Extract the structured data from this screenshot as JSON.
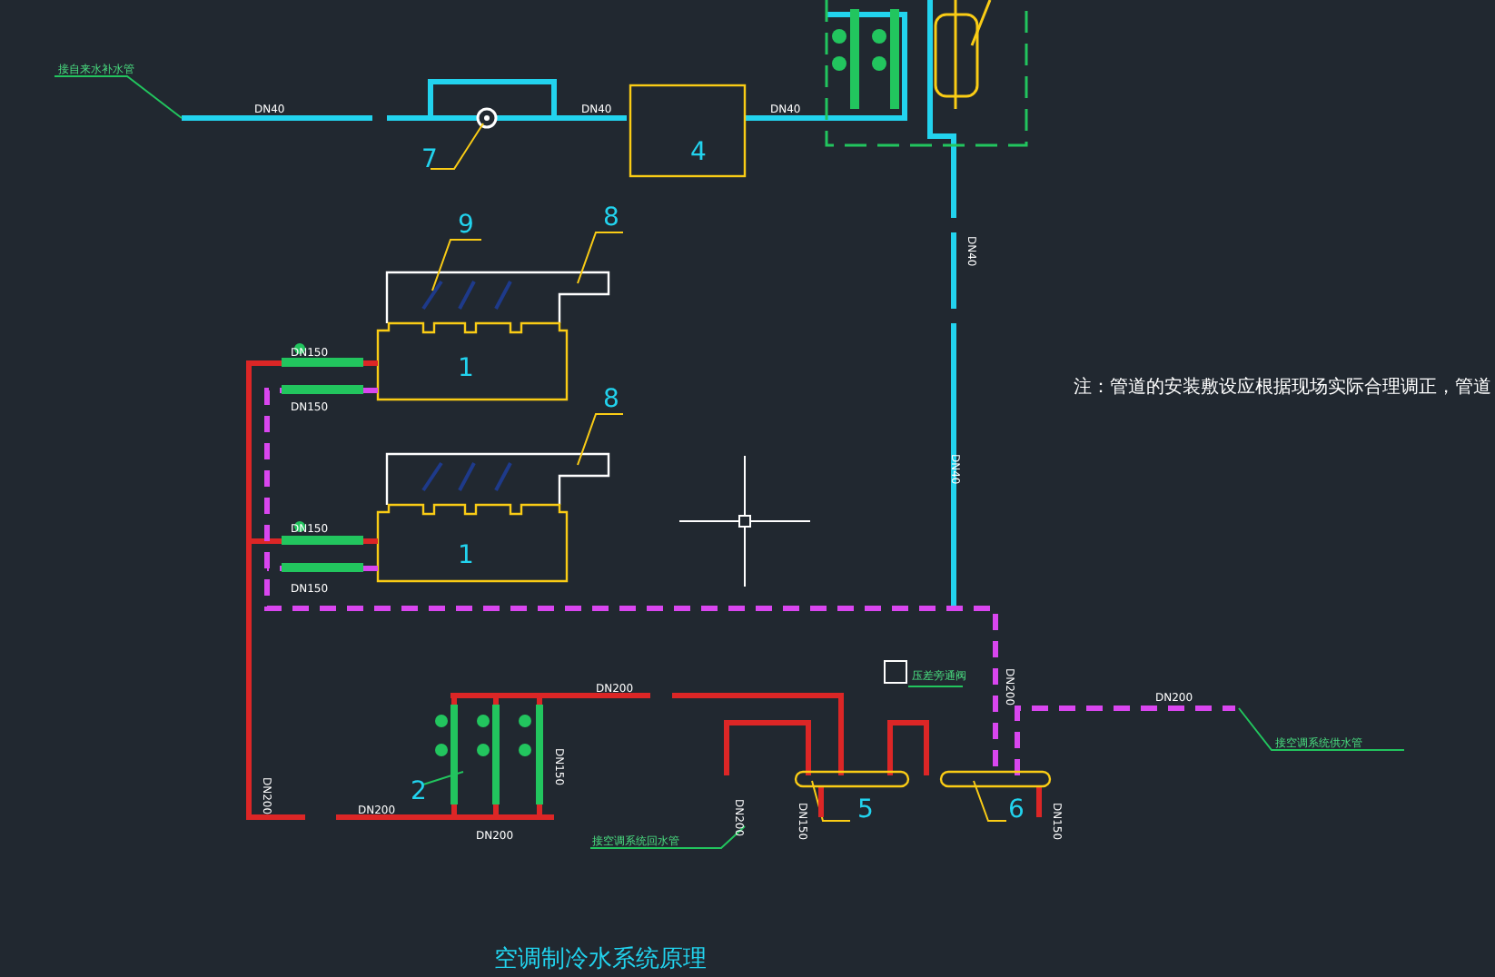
{
  "drawing": {
    "labels": [
      {
        "kind": "callout",
        "text": "接自来水补水管"
      },
      {
        "kind": "dn",
        "text": "DN40"
      },
      {
        "kind": "dn",
        "text": "DN40"
      },
      {
        "kind": "dn",
        "text": "DN40"
      },
      {
        "kind": "dn_v",
        "text": "DN40"
      },
      {
        "kind": "dn_v",
        "text": "DN40"
      },
      {
        "kind": "number",
        "text": "7"
      },
      {
        "kind": "number",
        "text": "4"
      },
      {
        "kind": "number",
        "text": "9"
      },
      {
        "kind": "number",
        "text": "8"
      },
      {
        "kind": "number",
        "text": "1"
      },
      {
        "kind": "number",
        "text": "8"
      },
      {
        "kind": "number",
        "text": "1"
      },
      {
        "kind": "dn",
        "text": "DN150"
      },
      {
        "kind": "dn",
        "text": "DN150"
      },
      {
        "kind": "dn",
        "text": "DN150"
      },
      {
        "kind": "dn",
        "text": "DN150"
      },
      {
        "kind": "note",
        "text": "注：管道的安装敷设应根据现场实际合理调正，管道"
      },
      {
        "kind": "dn",
        "text": "DN200"
      },
      {
        "kind": "dn_v",
        "text": "DN200"
      },
      {
        "kind": "dn",
        "text": "DN200"
      },
      {
        "kind": "dn",
        "text": "DN200"
      },
      {
        "kind": "dn_v",
        "text": "DN150"
      },
      {
        "kind": "number",
        "text": "2"
      },
      {
        "kind": "dn_v",
        "text": "DN200"
      },
      {
        "kind": "callout",
        "text": "接空调系统回水管"
      },
      {
        "kind": "callout",
        "text": "压差旁通阀"
      },
      {
        "kind": "dn_v",
        "text": "DN200"
      },
      {
        "kind": "dn",
        "text": "DN200"
      },
      {
        "kind": "callout",
        "text": "接空调系统供水管"
      },
      {
        "kind": "dn_v",
        "text": "DN150"
      },
      {
        "kind": "dn_v",
        "text": "DN150"
      },
      {
        "kind": "number",
        "text": "5"
      },
      {
        "kind": "number",
        "text": "6"
      },
      {
        "kind": "title",
        "text": "空调制冷水系统原理"
      }
    ]
  }
}
